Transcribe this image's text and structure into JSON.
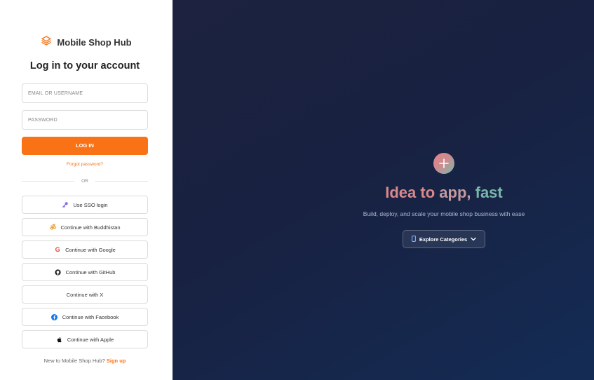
{
  "brand": {
    "name": "Mobile Shop Hub",
    "accent": "#f97316"
  },
  "login": {
    "title": "Log in to your account",
    "email_placeholder": "EMAIL OR USERNAME",
    "password_placeholder": "PASSWORD",
    "submit_label": "LOG IN",
    "forgot_label": "Forgot password?",
    "divider_label": "OR"
  },
  "providers": [
    {
      "label": "Use SSO login",
      "icon": "key-icon"
    },
    {
      "label": "Continue with Buddhistan",
      "icon": "om-icon"
    },
    {
      "label": "Continue with Google",
      "icon": "google-icon"
    },
    {
      "label": "Continue with GitHub",
      "icon": "github-icon"
    },
    {
      "label": "Continue with X",
      "icon": ""
    },
    {
      "label": "Continue with Facebook",
      "icon": "facebook-icon"
    },
    {
      "label": "Continue with Apple",
      "icon": "apple-icon"
    }
  ],
  "signup": {
    "prompt": "New to Mobile Shop Hub?",
    "link_label": "Sign up"
  },
  "hero": {
    "icon": "plus-icon",
    "title_part1": "Idea to",
    "title_part2": "app,",
    "title_part3": "fast",
    "subtitle": "Build, deploy, and scale your mobile shop business with ease",
    "explore_label": "Explore Categories",
    "colors": {
      "background": "#1a2244",
      "title_pink": "#d9888c",
      "title_teal": "#7ab6aa"
    }
  }
}
